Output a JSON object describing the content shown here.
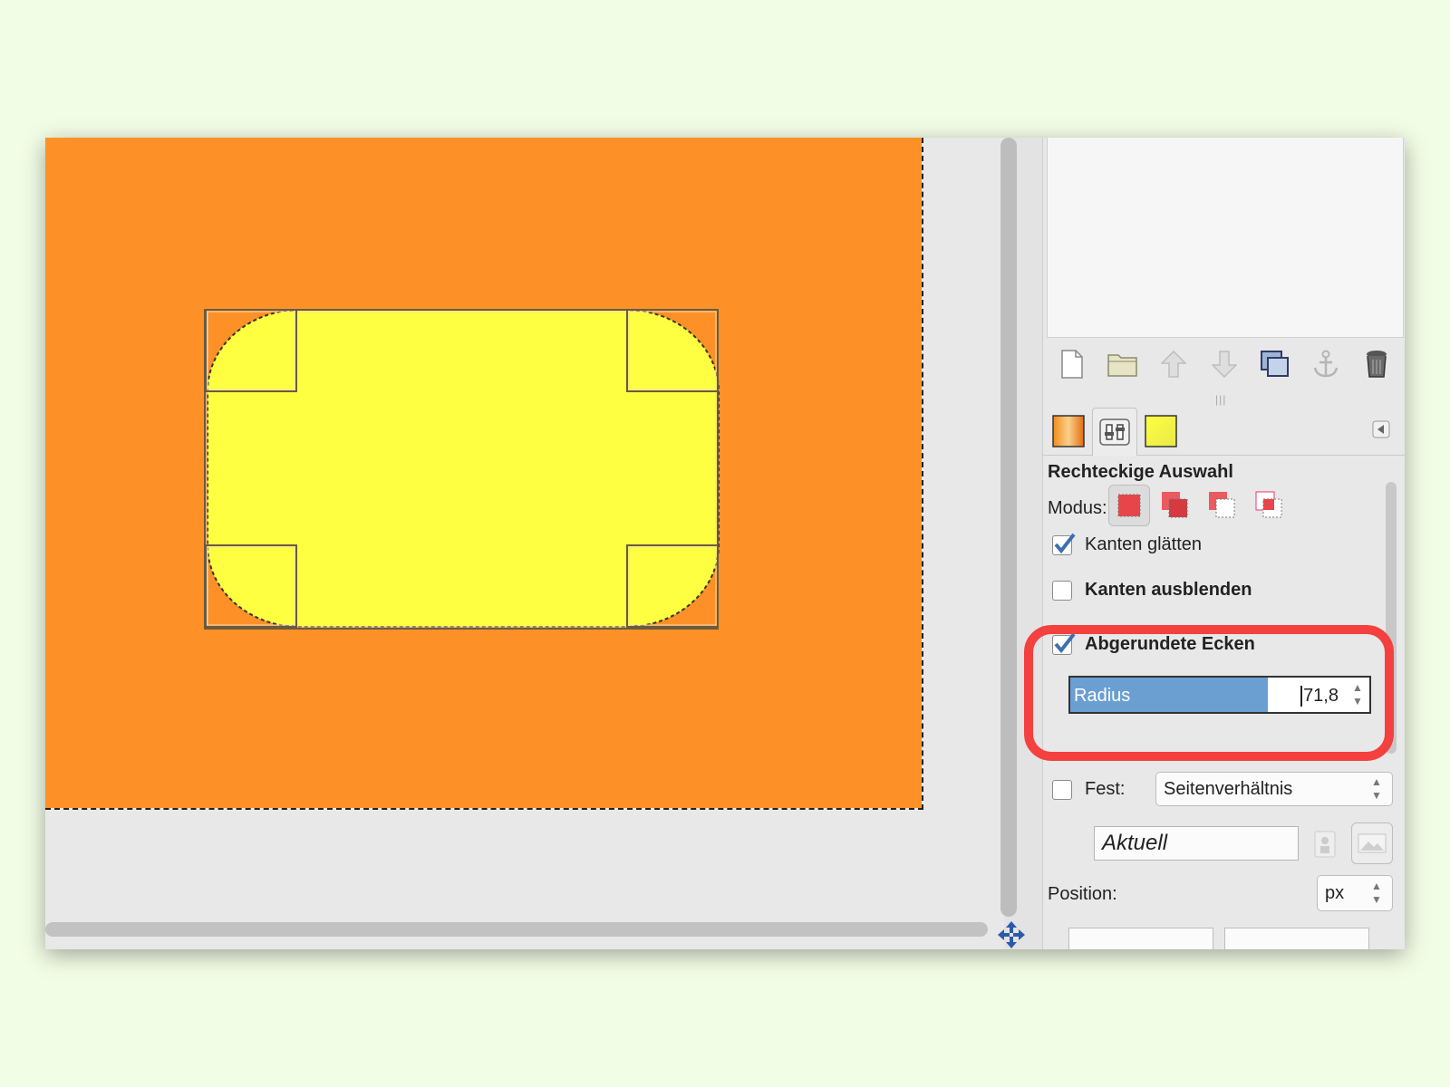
{
  "colors": {
    "canvas_orange": "#fd9127",
    "selection_yellow": "#ffff41",
    "highlight_red": "#f4403f",
    "radius_fill_blue": "#6b9fd2",
    "page_background": "#f2fde6"
  },
  "layers_toolbar": {
    "icons": [
      "new-layer-icon",
      "open-folder-icon",
      "raise-layer-icon",
      "lower-layer-icon",
      "duplicate-layer-icon",
      "anchor-icon",
      "delete-icon"
    ]
  },
  "tabs": {
    "items": [
      "gradient-tab-icon",
      "tool-options-tab-icon",
      "palette-tab-icon"
    ],
    "active": "tool-options-tab-icon"
  },
  "tool_options": {
    "title": "Rechteckige Auswahl",
    "mode_label": "Modus:",
    "modes": [
      "replace-mode-icon",
      "add-mode-icon",
      "subtract-mode-icon",
      "intersect-mode-icon"
    ],
    "antialias": {
      "label": "Kanten glätten",
      "checked": true
    },
    "feather": {
      "label": "Kanten ausblenden",
      "checked": false
    },
    "rounded_corners": {
      "label": "Abgerundete Ecken",
      "checked": true
    },
    "radius": {
      "label": "Radius",
      "value": "71,8",
      "fill_fraction": 0.66
    },
    "fixed": {
      "label": "Fest:",
      "checked": false,
      "value": "Seitenverhältnis"
    },
    "aktuell": {
      "value": "Aktuell"
    },
    "position": {
      "label": "Position:",
      "unit": "px"
    }
  }
}
